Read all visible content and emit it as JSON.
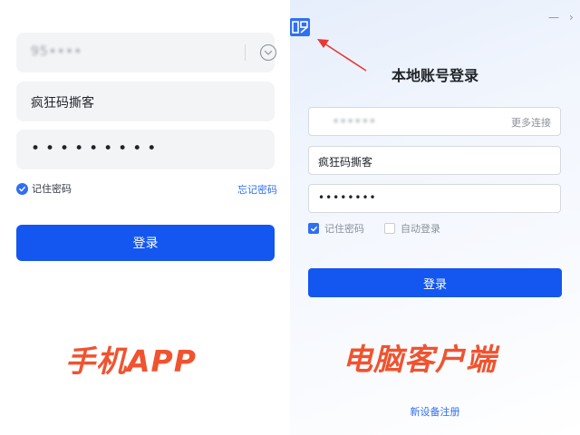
{
  "mobile": {
    "account_value": "95••••",
    "name_value": "疯狂码撕客",
    "password_mask": "•••••••••",
    "remember_label": "记住密码",
    "remember_checked": true,
    "forgot_label": "忘记密码",
    "login_label": "登录",
    "caption": "手机APP"
  },
  "desktop": {
    "title": "本地账号登录",
    "account_value": "••••••",
    "more_connections": "更多连接",
    "name_value": "疯狂码撕客",
    "password_mask": "••••••••",
    "remember_label": "记住密码",
    "remember_checked": true,
    "auto_login_label": "自动登录",
    "auto_login_checked": false,
    "login_label": "登录",
    "caption": "电脑客户端",
    "register_label": "新设备注册",
    "minimize_symbol": "—",
    "close_symbol": "›"
  },
  "colors": {
    "accent": "#1456f0",
    "link": "#2f6ff2",
    "caption": "#f0532f",
    "annotation_arrow": "#e53935"
  },
  "icons": [
    "chevron-down-icon",
    "check-icon",
    "app-logo-icon",
    "minimize-icon",
    "close-icon",
    "annotation-arrow-icon"
  ]
}
